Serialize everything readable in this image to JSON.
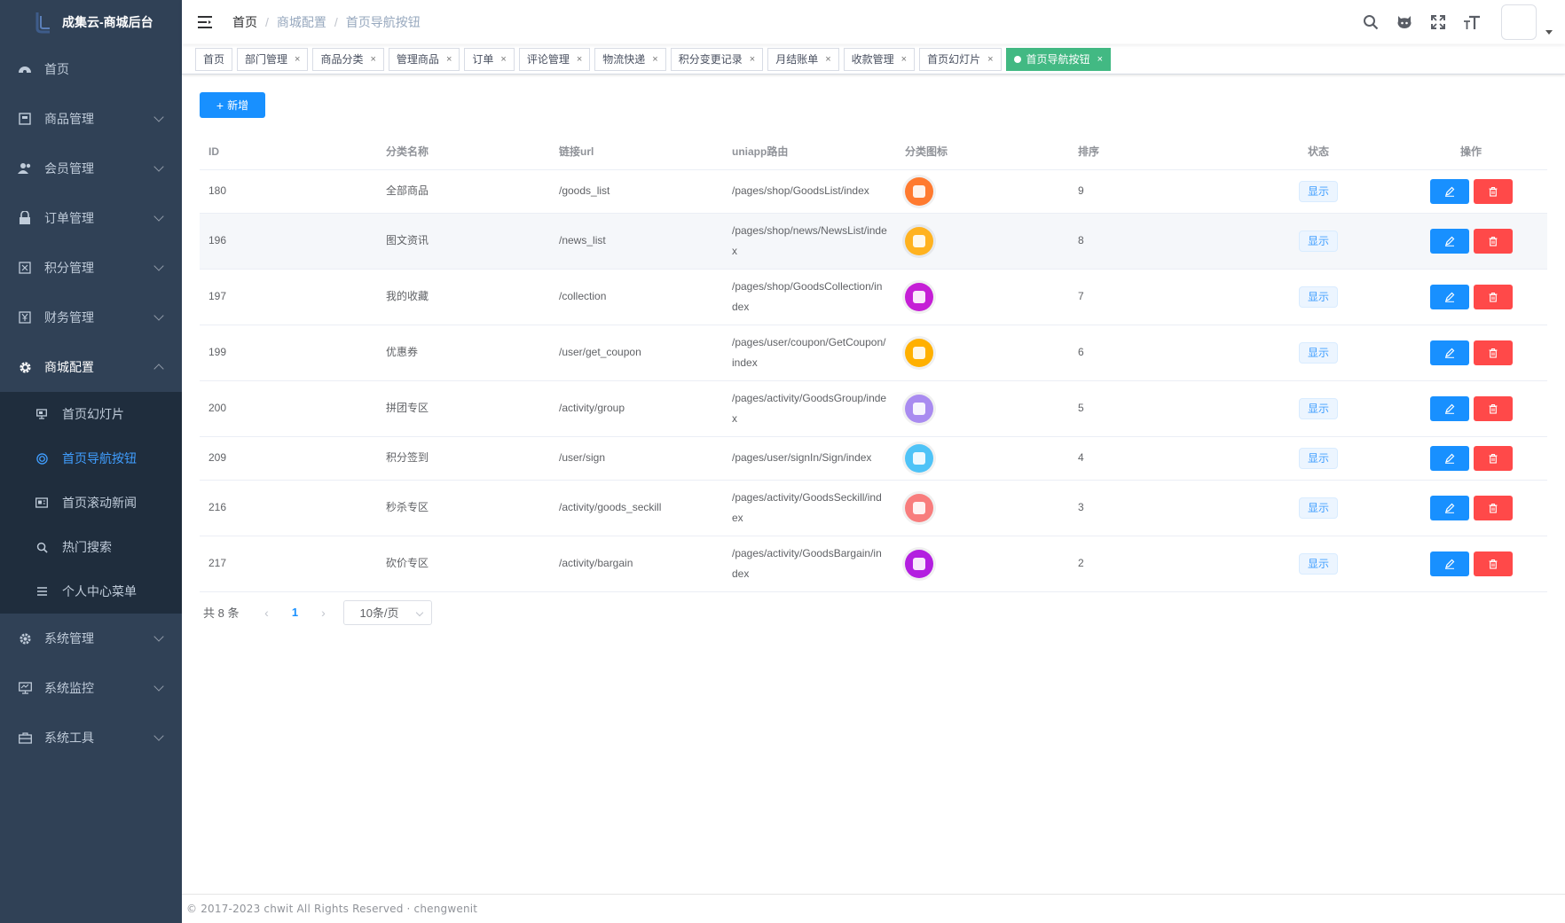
{
  "app": {
    "title": "成集云-商城后台"
  },
  "sidebar": {
    "items": [
      {
        "label": "首页",
        "icon": "dashboard-icon"
      },
      {
        "label": "商品管理",
        "icon": "goods-icon"
      },
      {
        "label": "会员管理",
        "icon": "users-icon"
      },
      {
        "label": "订单管理",
        "icon": "lock-icon"
      },
      {
        "label": "积分管理",
        "icon": "points-icon"
      },
      {
        "label": "财务管理",
        "icon": "finance-icon"
      },
      {
        "label": "商城配置",
        "icon": "gear-icon"
      },
      {
        "label": "系统管理",
        "icon": "settings-icon"
      },
      {
        "label": "系统监控",
        "icon": "monitor-icon"
      },
      {
        "label": "系统工具",
        "icon": "toolbox-icon"
      }
    ],
    "submenu": [
      {
        "label": "首页幻灯片",
        "icon": "slideshow-icon"
      },
      {
        "label": "首页导航按钮",
        "icon": "nav-button-icon"
      },
      {
        "label": "首页滚动新闻",
        "icon": "news-icon"
      },
      {
        "label": "热门搜索",
        "icon": "search-icon"
      },
      {
        "label": "个人中心菜单",
        "icon": "menu-list-icon"
      }
    ]
  },
  "breadcrumb": [
    "首页",
    "商城配置",
    "首页导航按钮"
  ],
  "tags": [
    "首页",
    "部门管理",
    "商品分类",
    "管理商品",
    "订单",
    "评论管理",
    "物流快递",
    "积分变更记录",
    "月结账单",
    "收款管理",
    "首页幻灯片",
    "首页导航按钮"
  ],
  "toolbar": {
    "add_label": "新增"
  },
  "table": {
    "headers": [
      "ID",
      "分类名称",
      "链接url",
      "uniapp路由",
      "分类图标",
      "排序",
      "状态",
      "操作"
    ],
    "rows": [
      {
        "id": "180",
        "name": "全部商品",
        "url": "/goods_list",
        "route": "/pages/shop/GoodsList/index",
        "sort": "9",
        "status": "显示",
        "icon_color": "#ff7a2f"
      },
      {
        "id": "196",
        "name": "图文资讯",
        "url": "/news_list",
        "route": "/pages/shop/news/NewsList/index",
        "sort": "8",
        "status": "显示",
        "icon_color": "#ffb21f"
      },
      {
        "id": "197",
        "name": "我的收藏",
        "url": "/collection",
        "route": "/pages/shop/GoodsCollection/index",
        "sort": "7",
        "status": "显示",
        "icon_color": "#c51fd6"
      },
      {
        "id": "199",
        "name": "优惠券",
        "url": "/user/get_coupon",
        "route": "/pages/user/coupon/GetCoupon/index",
        "sort": "6",
        "status": "显示",
        "icon_color": "#ffb000"
      },
      {
        "id": "200",
        "name": "拼团专区",
        "url": "/activity/group",
        "route": "/pages/activity/GoodsGroup/index",
        "sort": "5",
        "status": "显示",
        "icon_color": "#a98bf0"
      },
      {
        "id": "209",
        "name": "积分签到",
        "url": "/user/sign",
        "route": "/pages/user/signIn/Sign/index",
        "sort": "4",
        "status": "显示",
        "icon_color": "#4fc3f7"
      },
      {
        "id": "216",
        "name": "秒杀专区",
        "url": "/activity/goods_seckill",
        "route": "/pages/activity/GoodsSeckill/index",
        "sort": "3",
        "status": "显示",
        "icon_color": "#f87d7d"
      },
      {
        "id": "217",
        "name": "砍价专区",
        "url": "/activity/bargain",
        "route": "/pages/activity/GoodsBargain/index",
        "sort": "2",
        "status": "显示",
        "icon_color": "#b31fe0"
      }
    ]
  },
  "pagination": {
    "total_label": "共 8 条",
    "current_page": "1",
    "page_size": "10条/页"
  },
  "footer": {
    "text": "© 2017-2023 chwit All Rights Reserved · chengwenit"
  },
  "colors": {
    "sidebar_bg": "#304156",
    "submenu_bg": "#1f2d3d",
    "primary": "#1890ff",
    "active_tag": "#42b983",
    "danger": "#ff4949"
  }
}
